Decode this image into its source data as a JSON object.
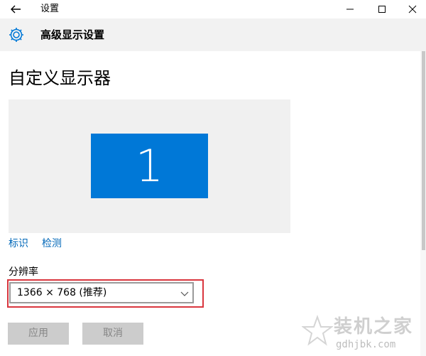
{
  "window": {
    "title": "设置",
    "controls": {
      "back": "arrow-left-icon",
      "minimize": "minimize-icon",
      "maximize": "maximize-icon",
      "close": "close-icon"
    }
  },
  "header": {
    "icon": "gear-icon",
    "title": "高级显示设置"
  },
  "page": {
    "title": "自定义显示器",
    "monitor_number": "1",
    "links": {
      "identify": "标识",
      "detect": "检测"
    },
    "resolution": {
      "label": "分辨率",
      "selected": "1366 × 768 (推荐)"
    },
    "buttons": {
      "apply": "应用",
      "cancel": "取消"
    }
  },
  "watermark": {
    "text": "装机之家",
    "url": "gdhjbk.com"
  },
  "colors": {
    "accent": "#0078d7",
    "link": "#0067b8",
    "highlight": "#d9363e",
    "header_bg": "#f2f2f2"
  }
}
